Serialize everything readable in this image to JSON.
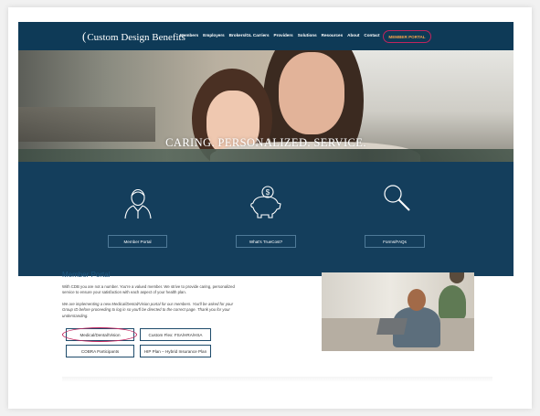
{
  "header": {
    "logo_mark": "(",
    "logo_text": "Custom Design Benefits",
    "nav": [
      "Members",
      "Employers",
      "Brokers/GL Carriers",
      "Providers",
      "Solutions",
      "Resources",
      "About",
      "Contact"
    ],
    "portal_button": "MEMBER PORTAL"
  },
  "hero": {
    "title": "CARING. PERSONALIZED. SERVICE."
  },
  "features": [
    {
      "icon": "person-icon",
      "label": "Member Portal"
    },
    {
      "icon": "piggy-bank-dollar-icon",
      "label": "What's TrueCost?"
    },
    {
      "icon": "magnifier-icon",
      "label": "Forms/FAQs"
    }
  ],
  "member_portal": {
    "heading": "Member Portal",
    "paragraph1": "With CDB you are not a number. You're a valued member. We strive to provide caring, personalized service to ensure your satisfaction with each aspect of your health plan.",
    "paragraph2": "We are implementing a new Medical/Dental/Vision portal for our members. You'll be asked for your Group ID before proceeding to log in so you'll be directed to the correct page. Thank you for your understanding.",
    "buttons": [
      "Medical/Dental/Vision",
      "Custom Flex: FSA/HRA/HSA",
      "COBRA Participants",
      "HIP Plan – Hybrid Insurance Plan"
    ]
  },
  "colors": {
    "navy": "#0e3a57",
    "features_bg": "#143e5c",
    "highlight": "#c0245e",
    "portal_text": "#f4a24a",
    "heading_blue": "#1e5780"
  }
}
